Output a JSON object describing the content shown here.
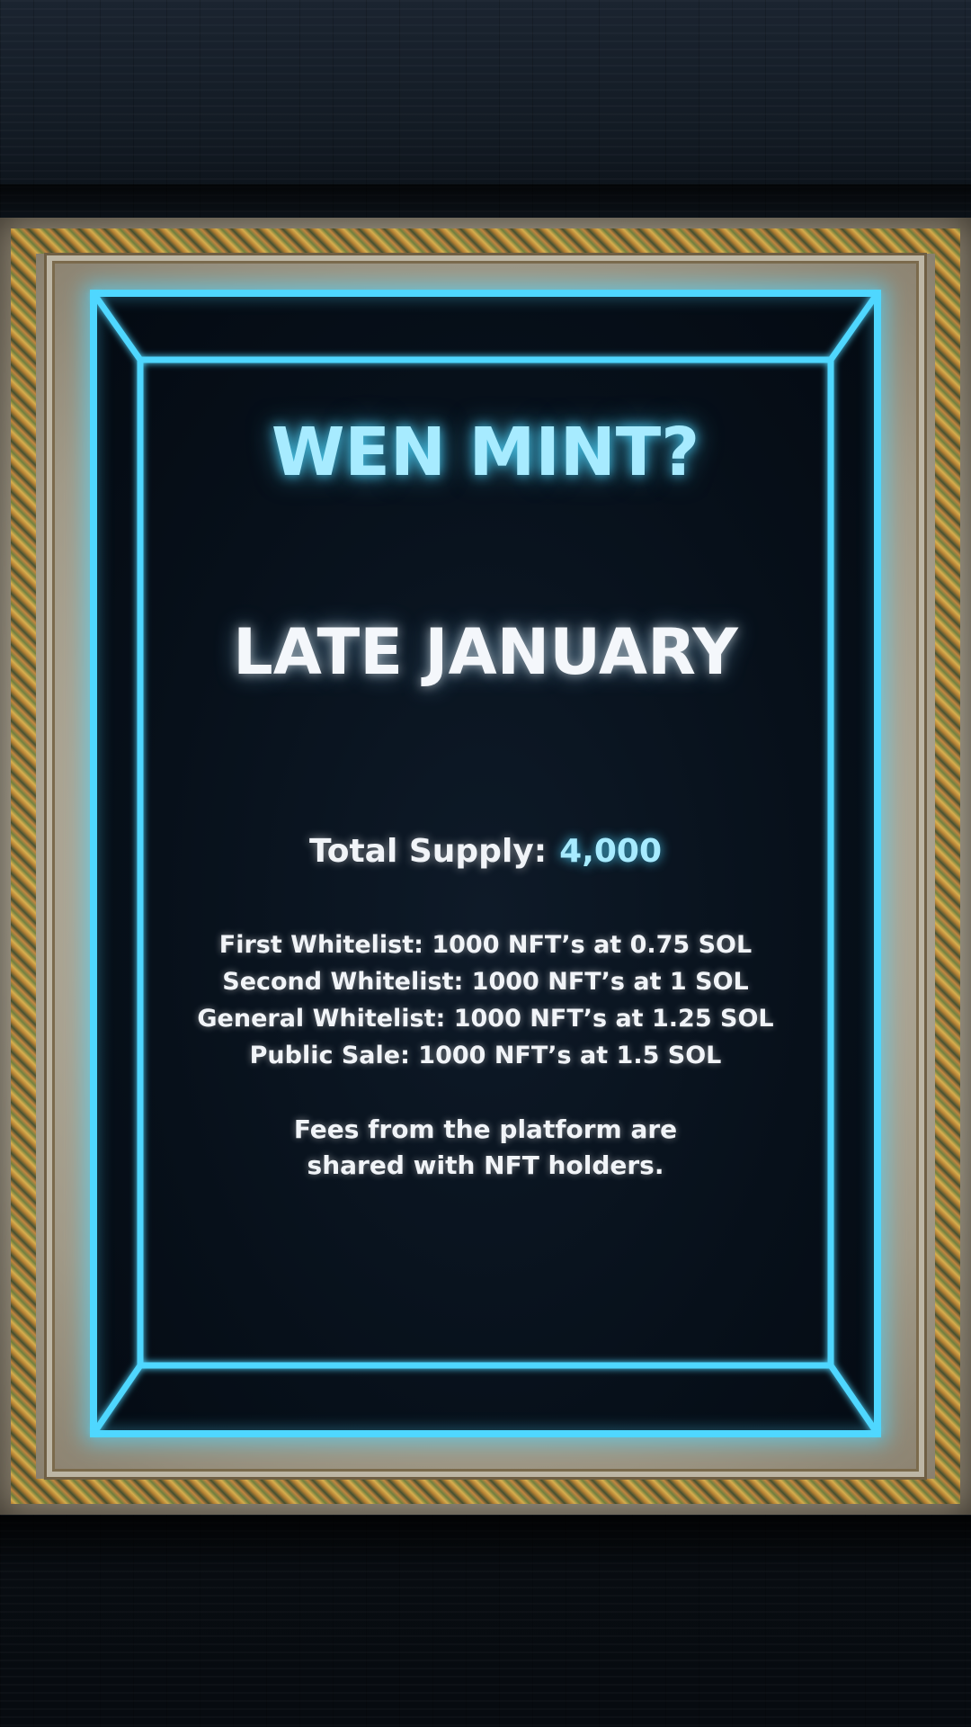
{
  "poster": {
    "headline": "WEN MINT?",
    "date": "LATE JANUARY",
    "supply": {
      "label": "Total Supply:",
      "value": "4,000"
    },
    "tiers": [
      "First Whitelist: 1000 NFT’s at 0.75 SOL",
      "Second Whitelist: 1000 NFT’s at 1 SOL",
      "General Whitelist: 1000 NFT’s at 1.25 SOL",
      "Public Sale: 1000 NFT’s at 1.5 SOL"
    ],
    "fees_note": {
      "line1": "Fees from the platform are",
      "line2": "shared with NFT holders."
    }
  },
  "colors": {
    "neon": "#4fd7ff",
    "accent_text": "#a7ebff",
    "panel_bg": "#07101a",
    "frame_gold": "#e0b24a"
  }
}
